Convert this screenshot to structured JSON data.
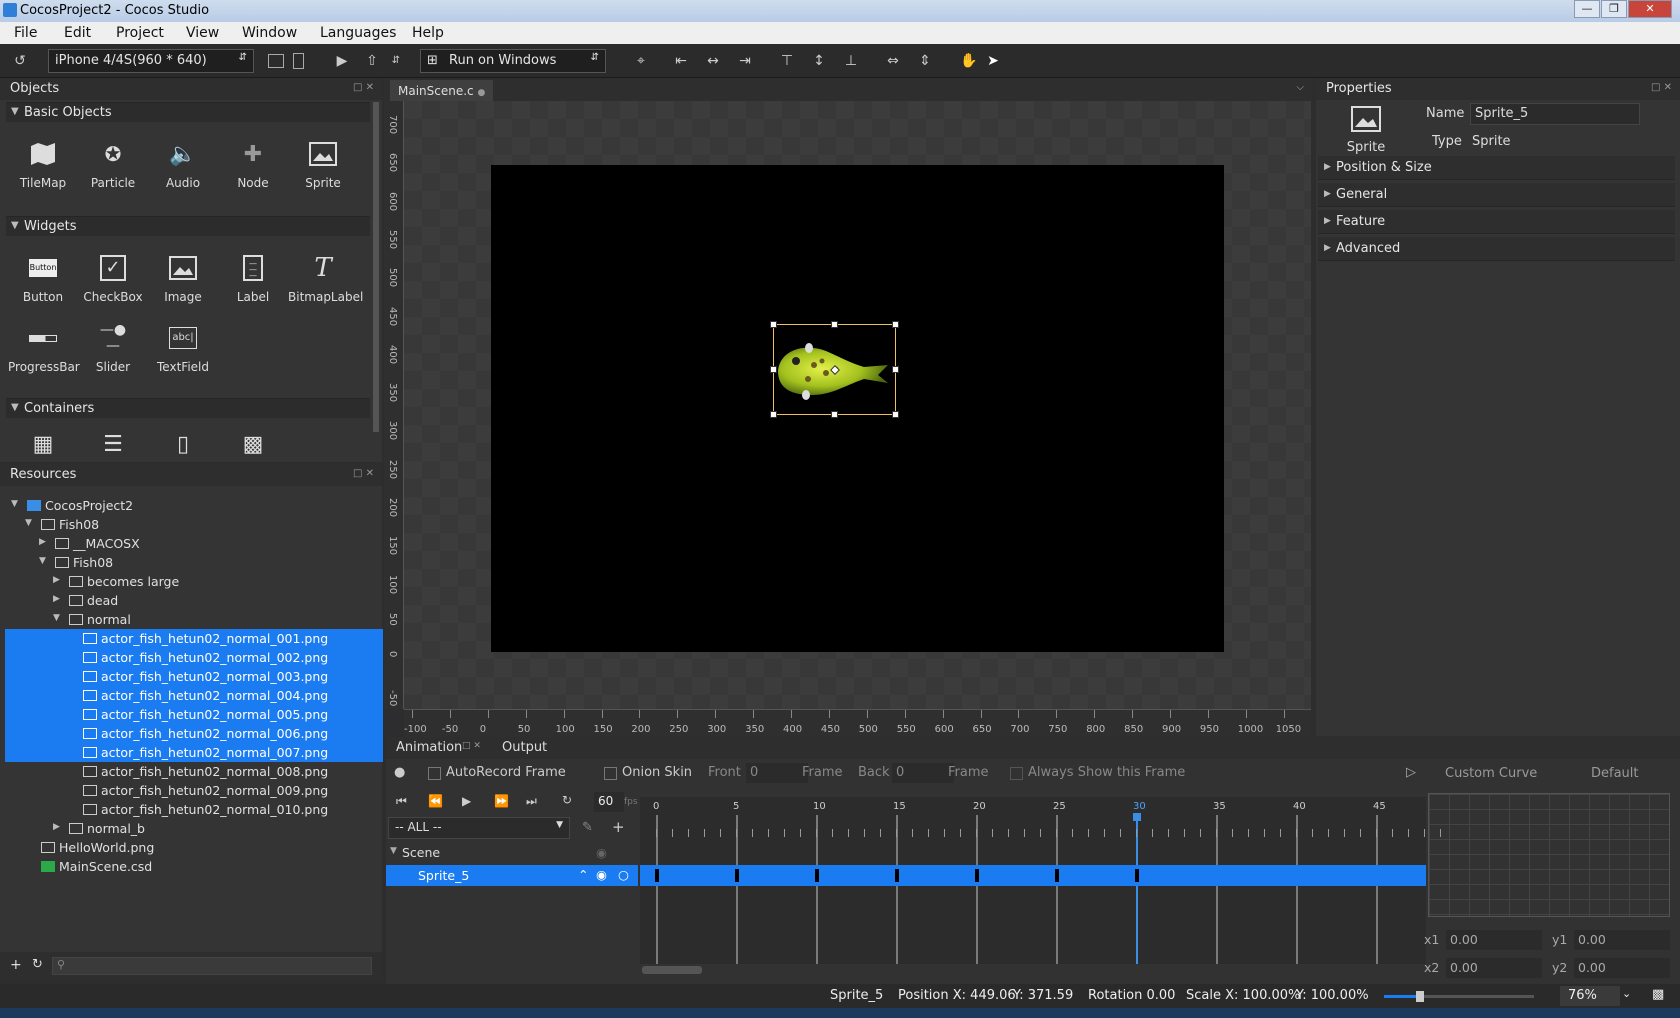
{
  "window": {
    "title": "CocosProject2 - Cocos Studio"
  },
  "menu": [
    "File",
    "Edit",
    "Project",
    "View",
    "Window",
    "Languages",
    "Help"
  ],
  "toolbar": {
    "device": "iPhone 4/4S(960 * 640)",
    "run_target": "Run on Windows"
  },
  "objects_panel": {
    "title": "Objects",
    "sections": [
      {
        "name": "Basic Objects",
        "items": [
          "TileMap",
          "Particle",
          "Audio",
          "Node",
          "Sprite"
        ]
      },
      {
        "name": "Widgets",
        "items": [
          "Button",
          "CheckBox",
          "Image",
          "Label",
          "BitmapLabel",
          "ProgressBar",
          "Slider",
          "TextField"
        ]
      },
      {
        "name": "Containers",
        "items": []
      }
    ]
  },
  "resources_panel": {
    "title": "Resources",
    "tree": [
      {
        "label": "CocosProject2",
        "depth": 0,
        "kind": "project",
        "open": true
      },
      {
        "label": "Fish08",
        "depth": 1,
        "kind": "folder",
        "open": true
      },
      {
        "label": "__MACOSX",
        "depth": 2,
        "kind": "folder",
        "open": false
      },
      {
        "label": "Fish08",
        "depth": 2,
        "kind": "folder",
        "open": true
      },
      {
        "label": "becomes large",
        "depth": 3,
        "kind": "folder",
        "open": false
      },
      {
        "label": "dead",
        "depth": 3,
        "kind": "folder",
        "open": false
      },
      {
        "label": "normal",
        "depth": 3,
        "kind": "folder",
        "open": true
      },
      {
        "label": "actor_fish_hetun02_normal_001.png",
        "depth": 4,
        "kind": "image",
        "selected": true
      },
      {
        "label": "actor_fish_hetun02_normal_002.png",
        "depth": 4,
        "kind": "image",
        "selected": true
      },
      {
        "label": "actor_fish_hetun02_normal_003.png",
        "depth": 4,
        "kind": "image",
        "selected": true
      },
      {
        "label": "actor_fish_hetun02_normal_004.png",
        "depth": 4,
        "kind": "image",
        "selected": true
      },
      {
        "label": "actor_fish_hetun02_normal_005.png",
        "depth": 4,
        "kind": "image",
        "selected": true
      },
      {
        "label": "actor_fish_hetun02_normal_006.png",
        "depth": 4,
        "kind": "image",
        "selected": true
      },
      {
        "label": "actor_fish_hetun02_normal_007.png",
        "depth": 4,
        "kind": "image",
        "selected": true
      },
      {
        "label": "actor_fish_hetun02_normal_008.png",
        "depth": 4,
        "kind": "image"
      },
      {
        "label": "actor_fish_hetun02_normal_009.png",
        "depth": 4,
        "kind": "image"
      },
      {
        "label": "actor_fish_hetun02_normal_010.png",
        "depth": 4,
        "kind": "image"
      },
      {
        "label": "normal_b",
        "depth": 3,
        "kind": "folder",
        "open": false
      },
      {
        "label": "HelloWorld.png",
        "depth": 1,
        "kind": "image"
      },
      {
        "label": "MainScene.csd",
        "depth": 1,
        "kind": "csd"
      }
    ]
  },
  "editor": {
    "tab": "MainScene.c",
    "ruler_v": [
      "700",
      "650",
      "600",
      "550",
      "500",
      "450",
      "400",
      "350",
      "300",
      "250",
      "200",
      "150",
      "100",
      "50",
      "0",
      "-50"
    ],
    "ruler_h": [
      "-100",
      "-50",
      "0",
      "50",
      "100",
      "150",
      "200",
      "250",
      "300",
      "350",
      "400",
      "450",
      "500",
      "550",
      "600",
      "650",
      "700",
      "750",
      "800",
      "850",
      "900",
      "950",
      "1000",
      "1050"
    ]
  },
  "properties": {
    "title": "Properties",
    "icon_label": "Sprite",
    "name_label": "Name",
    "name_value": "Sprite_5",
    "type_label": "Type",
    "type_value": "Sprite",
    "sections": [
      "Position & Size",
      "General",
      "Feature",
      "Advanced"
    ]
  },
  "animation": {
    "tabs": [
      "Animation",
      "Output"
    ],
    "autorecord": "AutoRecord Frame",
    "onion": "Onion Skin",
    "front_label": "Front",
    "front_value": "0",
    "frame1": "Frame",
    "back_label": "Back",
    "back_value": "0",
    "frame2": "Frame",
    "always_show": "Always Show this Frame",
    "fps_value": "60",
    "fps_unit": "fps",
    "filter": "-- ALL --",
    "scene_label": "Scene",
    "sprite_label": "Sprite_5",
    "frame_labels": [
      "0",
      "5",
      "10",
      "15",
      "20",
      "25",
      "30",
      "35",
      "40",
      "45"
    ],
    "current_frame": "30",
    "keyframes": [
      0,
      5,
      10,
      15,
      20,
      25,
      30
    ],
    "curve_title": "Custom Curve",
    "curve_preset": "Default",
    "x1_label": "x1",
    "x1": "0.00",
    "y1_label": "y1",
    "y1": "0.00",
    "x2_label": "x2",
    "x2": "0.00",
    "y2_label": "y2",
    "y2": "0.00"
  },
  "status": {
    "object": "Sprite_5",
    "position": "Position X: 449.06",
    "y": "Y: 371.59",
    "rotation": "Rotation 0.00",
    "scale_x": "Scale X: 100.00%",
    "scale_y": "Y: 100.00%",
    "zoom": "76%"
  }
}
